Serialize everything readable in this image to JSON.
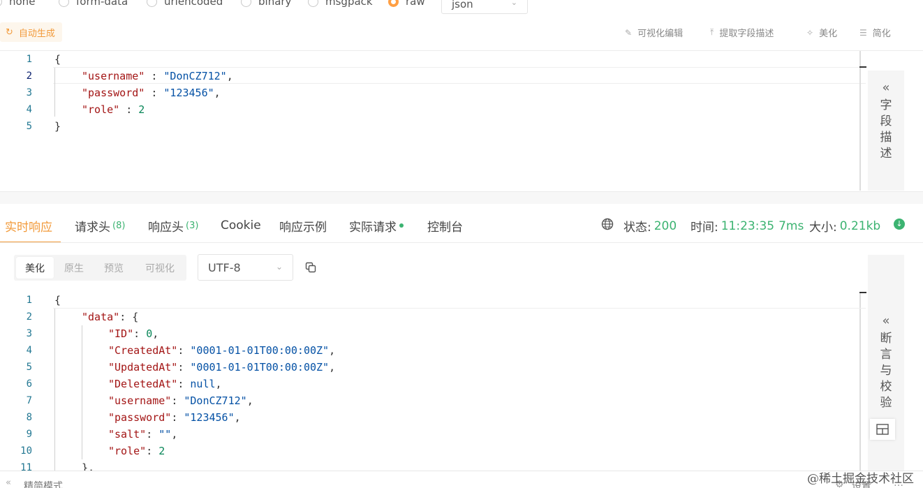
{
  "body_types": [
    {
      "label": "none",
      "selected": false
    },
    {
      "label": "form-data",
      "selected": false
    },
    {
      "label": "urlencoded",
      "selected": false
    },
    {
      "label": "binary",
      "selected": false
    },
    {
      "label": "msgpack",
      "selected": false
    },
    {
      "label": "raw",
      "selected": true
    }
  ],
  "raw_format": "json",
  "toolbar": {
    "auto_generate": "自动生成",
    "visual_edit": "可视化编辑",
    "extract_fields": "提取字段描述",
    "beautify": "美化",
    "simplify": "简化"
  },
  "request_editor": {
    "lines": [
      {
        "n": "1",
        "text": "{"
      },
      {
        "n": "2",
        "key": "\"username\"",
        "sep": " : ",
        "val": "\"DonCZ712\"",
        "end": ","
      },
      {
        "n": "3",
        "key": "\"password\"",
        "sep": " : ",
        "val": "\"123456\"",
        "end": ","
      },
      {
        "n": "4",
        "key": "\"role\"",
        "sep": " : ",
        "num": "2",
        "end": ""
      },
      {
        "n": "5",
        "text": "}"
      }
    ]
  },
  "side_panels": {
    "field_desc": [
      "字",
      "段",
      "描",
      "述"
    ],
    "assertions": [
      "断",
      "言",
      "与",
      "校",
      "验"
    ]
  },
  "response_tabs": [
    {
      "label": "实时响应",
      "count": "",
      "active": true
    },
    {
      "label": "请求头",
      "count": "(8)"
    },
    {
      "label": "响应头",
      "count": "(3)"
    },
    {
      "label": "Cookie",
      "count": ""
    },
    {
      "label": "响应示例",
      "count": ""
    },
    {
      "label": "实际请求",
      "count": ""
    },
    {
      "label": "控制台",
      "count": ""
    }
  ],
  "status_bar": {
    "status_label": "状态:",
    "status_value": "200",
    "time_label": "时间:",
    "time_value": "11:23:35",
    "duration": "7ms",
    "size_label": "大小:",
    "size_value": "0.21kb"
  },
  "view_modes": [
    "美化",
    "原生",
    "预览",
    "可视化"
  ],
  "encoding": "UTF-8",
  "response_editor": {
    "lines": [
      {
        "n": "1",
        "text": "{"
      },
      {
        "n": "2",
        "key": "\"data\"",
        "sep": ": ",
        "raw": "{"
      },
      {
        "n": "3",
        "key": "\"ID\"",
        "sep": ": ",
        "num": "0",
        "end": ","
      },
      {
        "n": "4",
        "key": "\"CreatedAt\"",
        "sep": ": ",
        "val": "\"0001-01-01T00:00:00Z\"",
        "end": ","
      },
      {
        "n": "5",
        "key": "\"UpdatedAt\"",
        "sep": ": ",
        "val": "\"0001-01-01T00:00:00Z\"",
        "end": ","
      },
      {
        "n": "6",
        "key": "\"DeletedAt\"",
        "sep": ": ",
        "kw": "null",
        "end": ","
      },
      {
        "n": "7",
        "key": "\"username\"",
        "sep": ": ",
        "val": "\"DonCZ712\"",
        "end": ","
      },
      {
        "n": "8",
        "key": "\"password\"",
        "sep": ": ",
        "val": "\"123456\"",
        "end": ","
      },
      {
        "n": "9",
        "key": "\"salt\"",
        "sep": ": ",
        "val": "\"\"",
        "end": ","
      },
      {
        "n": "10",
        "key": "\"role\"",
        "sep": ": ",
        "num": "2",
        "end": ""
      },
      {
        "n": "11",
        "text": "},"
      }
    ]
  },
  "footer": {
    "compact_mode": "精简模式",
    "settings": "设置",
    "watermark": "@稀土掘金技术社区"
  }
}
